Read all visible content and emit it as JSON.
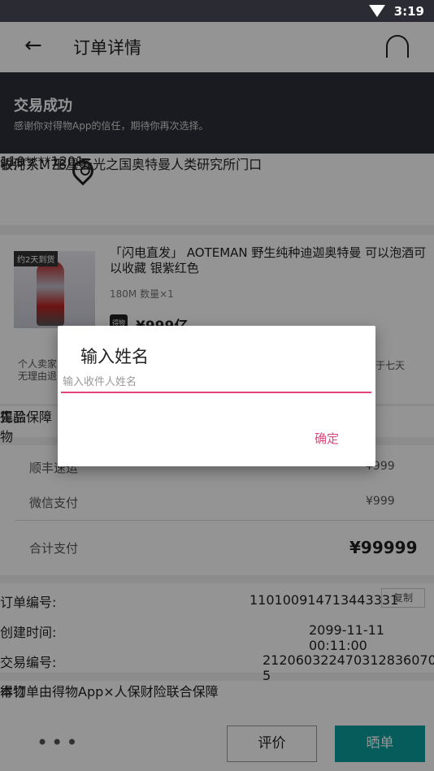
{
  "status_bar": {
    "time": "3:19"
  },
  "app_bar": {
    "title": "订单详情"
  },
  "banner": {
    "heading": "交易成功",
    "subtext": "感谢你对得物App的信任，期待你再次选择。"
  },
  "address": {
    "recipient": "收件人：王八蛋",
    "phone": "110****1201",
    "line": "银河系M78星云光之国奥特曼人类研究所门口"
  },
  "product": {
    "tag": "约2天到货",
    "title": "「闪电直发」 AOTEMAN 野生纯种迪迦奥特曼 可以泡酒可以收藏 银紫红色",
    "spec": "180M 数量×1",
    "logo_text": "得物",
    "price": "¥999亿"
  },
  "notes": {
    "left": "个人卖家\n无理由退",
    "right": "于七天"
  },
  "guarantee": {
    "logo_text": "得物",
    "text": "先验",
    "badge": "正品保障"
  },
  "fees": [
    {
      "label": "顺丰速运",
      "value": "¥999"
    },
    {
      "label": "微信支付",
      "value": "¥999"
    }
  ],
  "total": {
    "label": "合计支付",
    "value": "¥99999"
  },
  "order_info": {
    "order_no_label": "订单编号:",
    "order_no": "110100914713443331",
    "copy_label": "复制",
    "created_label": "创建时间:",
    "created": "2099-11-11 00:11:00",
    "trade_no_label": "交易编号:",
    "trade_no": "2120603224703128360708​5"
  },
  "insurance": {
    "logo_text": "得物",
    "text": "本订单由得物App×人保财险联合保障"
  },
  "bottom_bar": {
    "more": "•••",
    "review": "评价",
    "show": "晒单"
  },
  "dialog": {
    "title": "输入姓名",
    "placeholder": "输入收件人姓名",
    "confirm": "确定"
  },
  "colors": {
    "accent": "#e0457b",
    "teal": "#0b9e9e",
    "banner": "#2e3038"
  }
}
